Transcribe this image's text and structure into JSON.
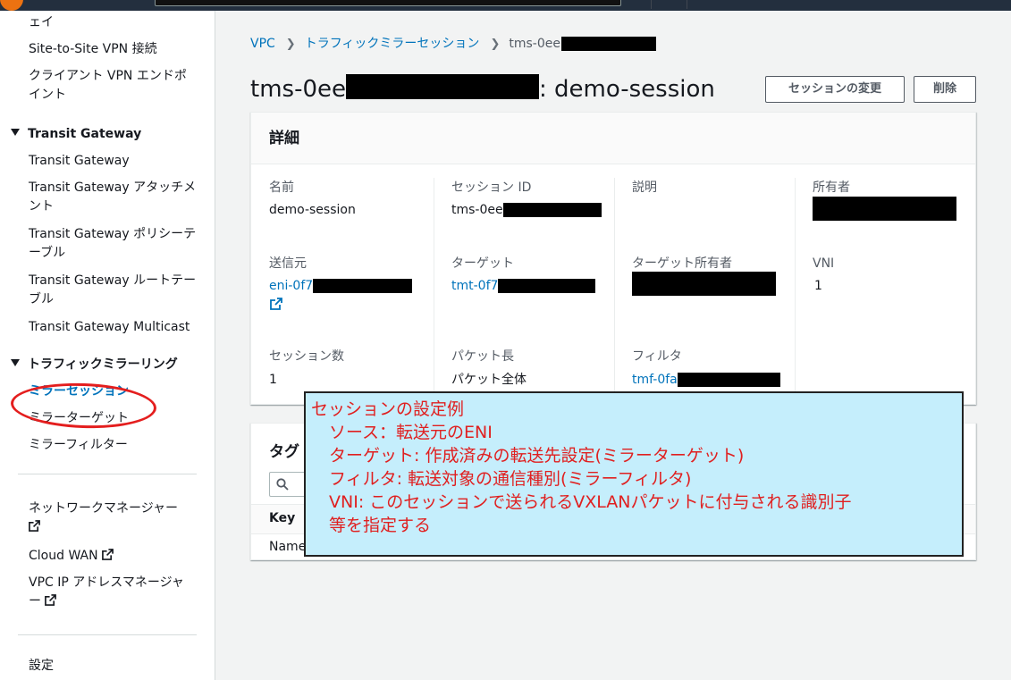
{
  "sidebar": {
    "items_top": [
      {
        "label": "ェイ"
      },
      {
        "label": "Site-to-Site VPN 接続"
      },
      {
        "label": "クライアント VPN エンドポ"
      },
      {
        "label": "イント"
      }
    ],
    "transit_section": "Transit Gateway",
    "transit_items": [
      "Transit Gateway",
      "Transit Gateway アタッチメ",
      "ント",
      "Transit Gateway ポリシーテ",
      "ーブル",
      "Transit Gateway ルートテー",
      "ブル",
      "Transit Gateway Multicast"
    ],
    "mirror_section": "トラフィックミラーリング",
    "mirror_items": [
      "ミラーセッション",
      "ミラーターゲット",
      "ミラーフィルター"
    ],
    "bottom_items": [
      "ネットワークマネージャー",
      "Cloud WAN",
      "VPC IP アドレスマネージャ",
      "ー"
    ],
    "settings": "設定"
  },
  "breadcrumb": {
    "vpc": "VPC",
    "sessions": "トラフィックミラーセッション",
    "current": "tms-0ee"
  },
  "title": {
    "prefix": "tms-0ee",
    "suffix": ": demo-session"
  },
  "buttons": {
    "modify": "セッションの変更",
    "delete": "削除"
  },
  "details": {
    "heading": "詳細",
    "name_label": "名前",
    "name_value": "demo-session",
    "session_id_label": "セッション ID",
    "session_id_value": "tms-0ee",
    "description_label": "説明",
    "owner_label": "所有者",
    "source_label": "送信元",
    "source_value": "eni-0f7",
    "target_label": "ターゲット",
    "target_value": "tmt-0f7",
    "target_owner_label": "ターゲット所有者",
    "vni_label": "VNI",
    "vni_value": "1",
    "session_number_label": "セッション数",
    "session_number_value": "1",
    "packet_length_label": "パケット長",
    "packet_length_value": "パケット全体",
    "filter_label": "フィルタ",
    "filter_value": "tmf-0fa"
  },
  "tags": {
    "heading": "タグ",
    "col_key": "Key",
    "row_name": "Name"
  },
  "callout": {
    "lines": [
      "セッションの設定例",
      "ソース：転送元のENI",
      "ターゲット:  作成済みの転送先設定(ミラーターゲット)",
      "フィルタ: 転送対象の通信種別(ミラーフィルタ)",
      "VNI: このセッションで送られるVXLANパケットに付与される識別子",
      "等を指定する"
    ]
  },
  "colors": {
    "link": "#0073bb",
    "annotation_red": "#e02020",
    "callout_bg": "#c5eefc",
    "aws_orange": "#ec7211"
  }
}
